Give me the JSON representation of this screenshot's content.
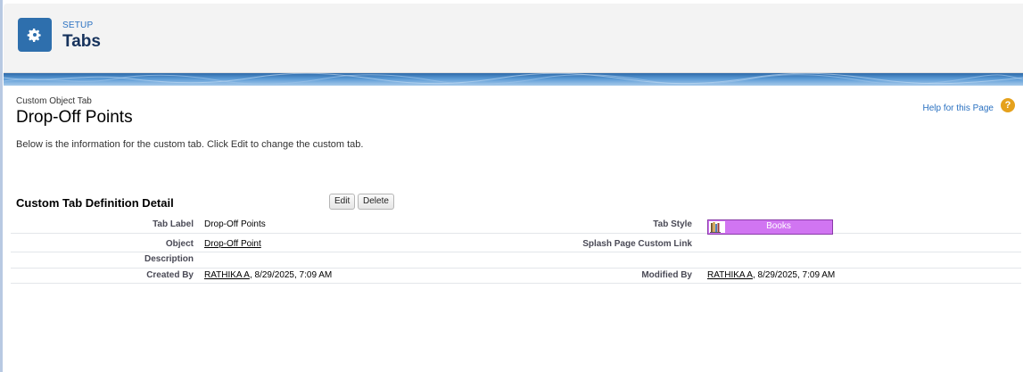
{
  "header": {
    "section_label": "SETUP",
    "title": "Tabs",
    "icon": "gear-icon"
  },
  "page": {
    "subtitle": "Custom Object Tab",
    "title": "Drop-Off Points",
    "help_link": "Help for this Page",
    "help_icon": "help-question-icon",
    "intro": "Below is the information for the custom tab. Click Edit to change the custom tab."
  },
  "detail": {
    "heading": "Custom Tab Definition Detail",
    "edit_label": "Edit",
    "delete_label": "Delete",
    "fields": {
      "tab_label": {
        "label": "Tab Label",
        "value": "Drop-Off Points"
      },
      "tab_style": {
        "label": "Tab Style",
        "value": "Books",
        "icon": "books-icon",
        "color": "#d175f2"
      },
      "object": {
        "label": "Object",
        "value": "Drop-Off Point"
      },
      "splash": {
        "label": "Splash Page Custom Link",
        "value": ""
      },
      "description": {
        "label": "Description",
        "value": ""
      },
      "created_by": {
        "label": "Created By",
        "user": "RATHIKA A",
        "date": ", 8/29/2025, 7:09 AM"
      },
      "modified_by": {
        "label": "Modified By",
        "user": "RATHIKA A",
        "date": ", 8/29/2025, 7:09 AM"
      }
    }
  },
  "colors": {
    "brand_icon_bg": "#2e6fad",
    "header_bg": "#f3f3f3",
    "link_blue": "#2a71c1"
  }
}
